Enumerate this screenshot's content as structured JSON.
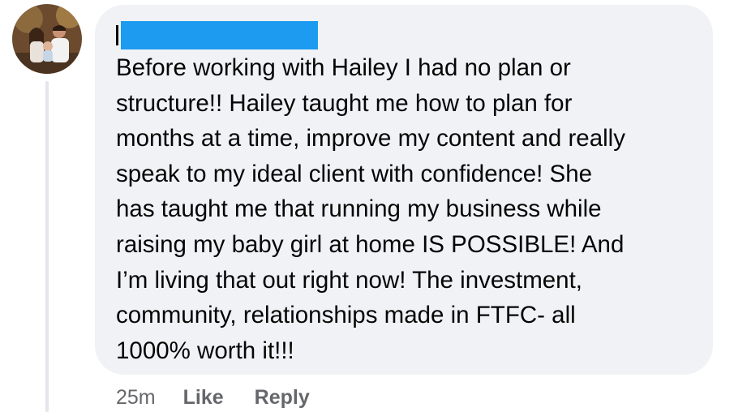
{
  "comment": {
    "author_name": "",
    "text": "Before working with Hailey I had no plan or\nstructure!! Hailey taught me how to plan for\nmonths at a time, improve my content and really\nspeak to my ideal client with confidence! She\nhas taught me that running my business while\nraising my baby girl at home IS POSSIBLE! And\nI’m living that out right now! The investment,\ncommunity, relationships made in FTFC- all\n1000% worth it!!!",
    "timestamp": "25m",
    "like_label": "Like",
    "reply_label": "Reply"
  },
  "colors": {
    "bubble_bg": "#f0f2f5",
    "redaction": "#1d9bf0",
    "text": "#050505",
    "secondary_text": "#65676b",
    "thread_line": "#e4e6eb"
  }
}
